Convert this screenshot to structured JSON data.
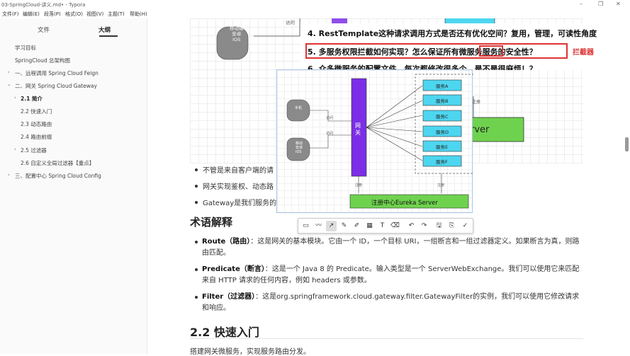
{
  "window": {
    "title": "03-SpringCloud-讲义.md• - Typora",
    "controls": {
      "minimize": "–",
      "maximize": "❐",
      "close": "✕"
    }
  },
  "menu": [
    "文件(F)",
    "编辑(E)",
    "段落(P)",
    "格式(O)",
    "视图(V)",
    "主题(T)",
    "帮助(H)"
  ],
  "sidebar": {
    "tabs": {
      "files": "文件",
      "outline": "大纲"
    },
    "outline": [
      {
        "label": "学习目标",
        "level": 0,
        "caret": ""
      },
      {
        "label": "SpringCloud 总架构图",
        "level": 0,
        "caret": ""
      },
      {
        "label": "一、远程调用 Spring Cloud Feign",
        "level": 0,
        "caret": "›"
      },
      {
        "label": "二、网关 Spring Cloud Gateway",
        "level": 0,
        "caret": "⌄"
      },
      {
        "label": "2.1 简介",
        "level": 1,
        "caret": "›",
        "active": true
      },
      {
        "label": "2.2 快速入门",
        "level": 1,
        "caret": ""
      },
      {
        "label": "2.3 动态路由",
        "level": 1,
        "caret": ""
      },
      {
        "label": "2.4 路由前缀",
        "level": 1,
        "caret": ""
      },
      {
        "label": "2.5 过滤器",
        "level": 1,
        "caret": "›"
      },
      {
        "label": "2.6 自定义全局过滤器【重点】",
        "level": 1,
        "caret": ""
      },
      {
        "label": "三、配置中心 Spring Cloud Config",
        "level": 0,
        "caret": "›"
      }
    ]
  },
  "background_diagram": {
    "mobile_client": "移动端\n安卓\nIOS",
    "access_label": "访问",
    "server_label": "rver"
  },
  "questions": {
    "q4": "4. RestTemplate这种请求调用方式是否还有优化空间？复用，管理，可读性角度",
    "q5": "5. 多服务权限拦截如何实现？怎么保证所有微服务服务的安全性？",
    "q6": "6. 众多微服务的配置文件，每次都修改很多个，是不是很麻烦！？",
    "interceptor": "拦截器"
  },
  "popup_diagram": {
    "client1": "手机",
    "client2": "移动\n安卓\nIOS",
    "access": "访问",
    "gateway": "网关",
    "services": [
      "服务A",
      "服务B",
      "服务C",
      "服务D",
      "服务E",
      "服务F"
    ],
    "register": "注册",
    "registry": "注册中心Eureka Server"
  },
  "toolbar": {
    "tools": [
      "rect-tool",
      "pen-tool",
      "arrow-tool",
      "pencil-tool",
      "marker-tool",
      "mosaic-tool",
      "text-tool",
      "eraser-tool",
      "undo",
      "redo",
      "save",
      "copy",
      "confirm"
    ],
    "glyphs": [
      "▭",
      "〰",
      "↗",
      "✎",
      "✐",
      "▦",
      "T",
      "⌫",
      "↶",
      "↷",
      "🖫",
      "⎘",
      "✓"
    ]
  },
  "content": {
    "bullets": [
      "不管是来自客户端的请",
      "网关实现鉴权、动态路",
      "Gateway是我们服务的"
    ],
    "terms_heading": "术语解释",
    "terms": [
      {
        "term": "Route（路由）",
        "text": "：这是网关的基本模块。它由一个 ID，一个目标 URI，一组断言和一组过滤器定义。如果断言为真，则路由匹配。"
      },
      {
        "term": "Predicate（断言）",
        "text": "：这是一个 Java 8 的 Predicate。输入类型是一个 ServerWebExchange。我们可以使用它来匹配来自 HTTP 请求的任何内容，例如 headers 或参数。"
      },
      {
        "term": "Filter（过滤器）",
        "text": "：这是org.springframework.cloud.gateway.filter.GatewayFilter的实例，我们可以使用它修改请求和响应。"
      }
    ],
    "quickstart_heading": "2.2 快速入门",
    "quickstart_text": "搭建网关微服务，实现服务路由分发。"
  },
  "colors": {
    "gateway": "#7b2ee6",
    "service": "#4dd6f0",
    "registry": "#6fd24f",
    "highlight": "#dd3333"
  }
}
